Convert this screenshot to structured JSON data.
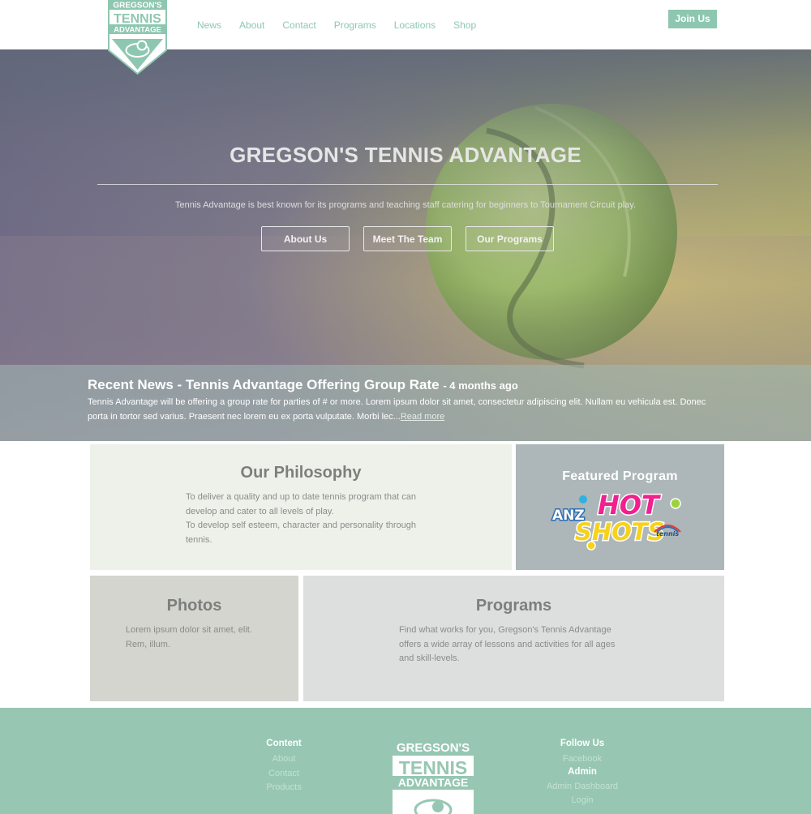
{
  "brand": {
    "logo_line1": "GREGSON'S",
    "logo_line2": "TENNIS",
    "logo_line3": "ADVANTAGE"
  },
  "nav": {
    "items": [
      "News",
      "About",
      "Contact",
      "Programs",
      "Locations",
      "Shop"
    ],
    "join_label": "Join Us"
  },
  "hero": {
    "title": "GREGSON'S TENNIS ADVANTAGE",
    "subtitle": "Tennis Advantage is best known for its programs and teaching staff catering for beginners to Tournament Circuit play.",
    "buttons": [
      "About Us",
      "Meet The Team",
      "Our Programs"
    ]
  },
  "news": {
    "title": "Recent News - Tennis Advantage Offering Group Rate",
    "time": "- 4 months ago",
    "text": "Tennis Advantage will be offering a group rate for parties of # or more. Lorem ipsum dolor sit amet, consectetur adipiscing elit. Nullam eu vehicula est. Donec porta in tortor sed varius. Praesent nec lorem eu ex porta vulputate. Morbi lec...",
    "read_more": "Read more"
  },
  "philosophy": {
    "title": "Our Philosophy",
    "line1": "To deliver a quality and up to date tennis program that can develop and cater to all levels of play.",
    "line2": "To develop self esteem, character and personality through tennis."
  },
  "featured": {
    "title": "Featured Program",
    "logo_anz": "ANZ",
    "logo_hot": "HOT",
    "logo_shots": "SHOTS",
    "logo_tennis": "tennis"
  },
  "photos": {
    "title": "Photos",
    "text": "Lorem ipsum dolor sit amet, elit. Rem, illum."
  },
  "programs": {
    "title": "Programs",
    "text": "Find what works for you, Gregson's Tennis Advantage offers a wide array of lessons and activities for all ages and skill-levels."
  },
  "footer": {
    "content_head": "Content",
    "content_links": [
      "About",
      "Contact",
      "Products"
    ],
    "follow_head": "Follow Us",
    "follow_links": [
      "Facebook"
    ],
    "admin_head": "Admin",
    "admin_links": [
      "Admin Dashboard",
      "Login"
    ]
  },
  "colors": {
    "accent": "#8ec7b0",
    "footer": "#97c7b2"
  }
}
